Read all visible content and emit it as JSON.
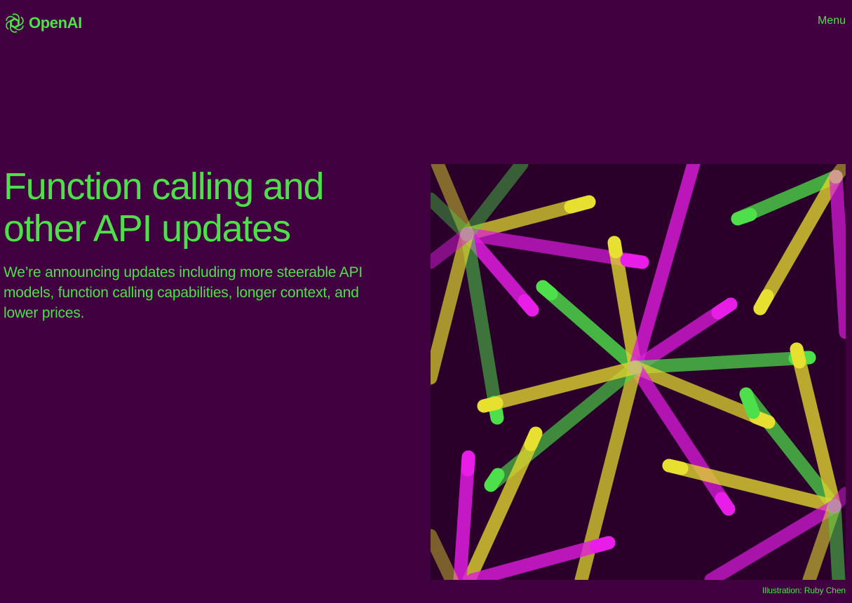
{
  "header": {
    "brand": "OpenAI",
    "logo_icon": "openai-logo-icon",
    "menu_label": "Menu"
  },
  "hero": {
    "title_line_1": "Function calling and",
    "title_line_2": "other API updates",
    "subtitle": "We’re announcing updates including more steerable API models, function calling capabilities, longer context, and lower prices."
  },
  "illustration": {
    "caption": "Illustration: Ruby Chen",
    "colors": {
      "background": "#2a002b",
      "magenta": "#e81ee8",
      "green": "#4ee04a",
      "yellow": "#e8e030"
    }
  },
  "colors": {
    "page_background": "#410040",
    "accent": "#4ee04a"
  }
}
